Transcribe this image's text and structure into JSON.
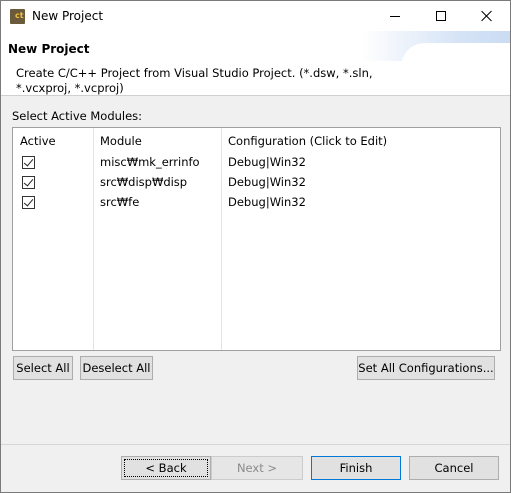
{
  "window": {
    "title": "New Project",
    "controls": {
      "minimize": "minimize",
      "maximize": "maximize",
      "close": "close"
    }
  },
  "header": {
    "title": "New Project",
    "description_line1": "Create C/C++ Project from Visual Studio Project. (*.dsw, *.sln,",
    "description_line2": "*.vcxproj, *.vcproj)"
  },
  "modules": {
    "label": "Select Active Modules:",
    "columns": [
      "Active",
      "Module",
      "Configuration (Click to Edit)"
    ],
    "rows": [
      {
        "active": true,
        "module": "misc₩mk_errinfo",
        "configuration": "Debug|Win32"
      },
      {
        "active": true,
        "module": "src₩disp₩disp",
        "configuration": "Debug|Win32"
      },
      {
        "active": true,
        "module": "src₩fe",
        "configuration": "Debug|Win32"
      }
    ]
  },
  "buttons": {
    "select_all": "Select All",
    "deselect_all": "Deselect All",
    "set_all_configurations": "Set All Configurations...",
    "back": "< Back",
    "next": "Next >",
    "finish": "Finish",
    "cancel": "Cancel"
  },
  "icons": {
    "app": "cdt-app-icon",
    "checkbox": "checked-checkbox-icon"
  }
}
